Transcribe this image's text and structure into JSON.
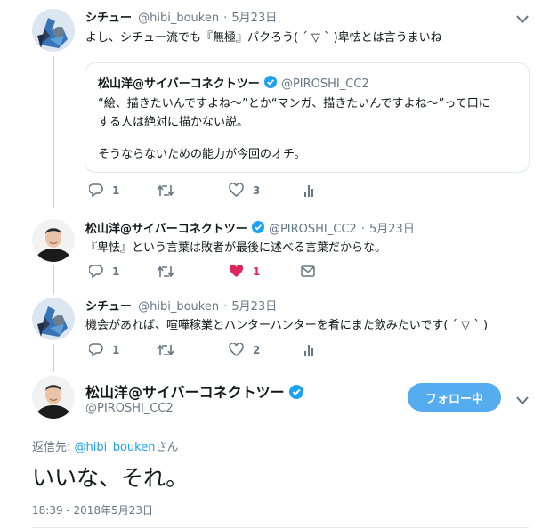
{
  "tweet1": {
    "display_name": "シチュー",
    "handle": "@hibi_bouken",
    "separator": "·",
    "date": "5月23日",
    "text": "よし、シチュー流でも『無極』パクろう( ´ ▽ ` )卑怯とは言うまいね",
    "quote": {
      "display_name": "松山洋@サイバーコネクトツー",
      "handle": "@PIROSHI_CC2",
      "line1": "“絵、描きたいんですよね～”とか“マンガ、描きたいんですよね～”って口に",
      "line2": "する人は絶対に描かない説。",
      "line3": "そうならないための能力が今回のオチ。"
    },
    "actions": {
      "reply_count": "1",
      "like_count": "3"
    }
  },
  "tweet2": {
    "display_name": "松山洋@サイバーコネクトツー",
    "handle": "@PIROSHI_CC2",
    "separator": "·",
    "date": "5月23日",
    "text": "『卑怯』という言葉は敗者が最後に述べる言葉だからな。",
    "actions": {
      "reply_count": "1",
      "like_count": "1"
    }
  },
  "tweet3": {
    "display_name": "シチュー",
    "handle": "@hibi_bouken",
    "separator": "·",
    "date": "5月23日",
    "text": "機会があれば、喧嘩稼業とハンターハンターを肴にまた飲みたいです( ´ ▽ ` )",
    "actions": {
      "reply_count": "1",
      "like_count": "2"
    }
  },
  "main_tweet": {
    "display_name": "松山洋@サイバーコネクトツー",
    "handle": "@PIROSHI_CC2",
    "follow_label": "フォロー中",
    "reply_to_prefix": "返信先: ",
    "reply_to_handle": "@hibi_bouken",
    "reply_to_suffix": "さん",
    "text": "いいな、それ。",
    "timestamp": "18:39 - 2018年5月23日"
  },
  "colors": {
    "accent": "#1da1f2",
    "follow_button": "#55acee",
    "like_active": "#e0245e",
    "muted": "#657786"
  }
}
